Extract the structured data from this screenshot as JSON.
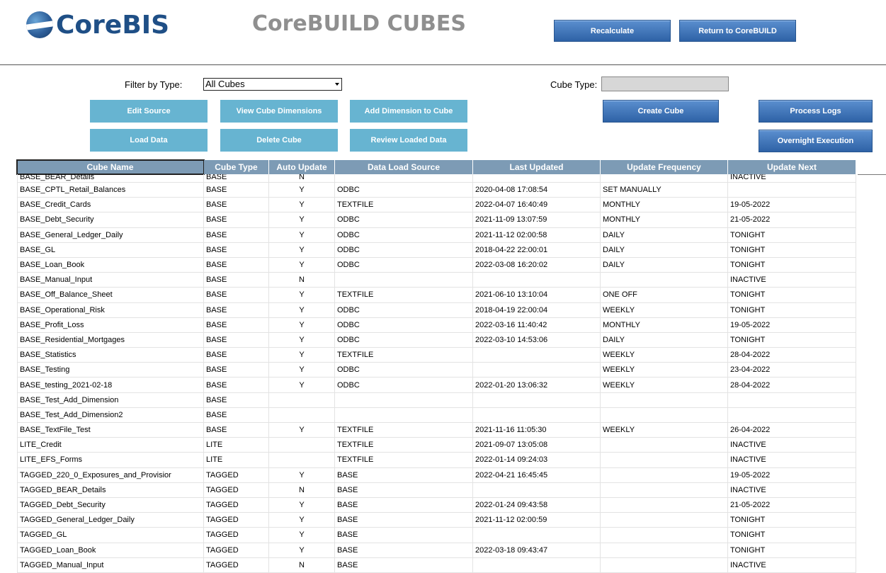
{
  "header": {
    "logo_text": "CoreBIS",
    "app_title": "CoreBUILD CUBES",
    "recalculate_label": "Recalculate",
    "return_label": "Return to CoreBUILD"
  },
  "filters": {
    "filter_by_type_label": "Filter by Type:",
    "filter_by_type_value": "All Cubes",
    "cube_type_label": "Cube Type:",
    "cube_type_value": ""
  },
  "actions": {
    "edit_source": "Edit Source",
    "view_cube_dimensions": "View Cube Dimensions",
    "add_dimension": "Add Dimension to Cube",
    "load_data": "Load Data",
    "delete_cube": "Delete Cube",
    "review_loaded_data": "Review Loaded Data",
    "create_cube": "Create Cube",
    "process_logs": "Process Logs",
    "overnight_execution": "Overnight Execution"
  },
  "table": {
    "columns": [
      "Cube Name",
      "Cube Type",
      "Auto Update",
      "Data Load Source",
      "Last Updated",
      "Update Frequency",
      "Update Next"
    ],
    "rows": [
      [
        "BASE_BEAR_Details",
        "BASE",
        "N",
        "",
        "",
        "",
        "INACTIVE"
      ],
      [
        "BASE_CPTL_Retail_Balances",
        "BASE",
        "Y",
        "ODBC",
        "2020-04-08 17:08:54",
        "SET MANUALLY",
        ""
      ],
      [
        "BASE_Credit_Cards",
        "BASE",
        "Y",
        "TEXTFILE",
        "2022-04-07 16:40:49",
        "MONTHLY",
        "19-05-2022"
      ],
      [
        "BASE_Debt_Security",
        "BASE",
        "Y",
        "ODBC",
        "2021-11-09 13:07:59",
        "MONTHLY",
        "21-05-2022"
      ],
      [
        "BASE_General_Ledger_Daily",
        "BASE",
        "Y",
        "ODBC",
        "2021-11-12 02:00:58",
        "DAILY",
        "TONIGHT"
      ],
      [
        "BASE_GL",
        "BASE",
        "Y",
        "ODBC",
        "2018-04-22 22:00:01",
        "DAILY",
        "TONIGHT"
      ],
      [
        "BASE_Loan_Book",
        "BASE",
        "Y",
        "ODBC",
        "2022-03-08 16:20:02",
        "DAILY",
        "TONIGHT"
      ],
      [
        "BASE_Manual_Input",
        "BASE",
        "N",
        "",
        "",
        "",
        "INACTIVE"
      ],
      [
        "BASE_Off_Balance_Sheet",
        "BASE",
        "Y",
        "TEXTFILE",
        "2021-06-10 13:10:04",
        "ONE OFF",
        "TONIGHT"
      ],
      [
        "BASE_Operational_Risk",
        "BASE",
        "Y",
        "ODBC",
        "2018-04-19 22:00:04",
        "WEEKLY",
        "TONIGHT"
      ],
      [
        "BASE_Profit_Loss",
        "BASE",
        "Y",
        "ODBC",
        "2022-03-16 11:40:42",
        "MONTHLY",
        "19-05-2022"
      ],
      [
        "BASE_Residential_Mortgages",
        "BASE",
        "Y",
        "ODBC",
        "2022-03-10 14:53:06",
        "DAILY",
        "TONIGHT"
      ],
      [
        "BASE_Statistics",
        "BASE",
        "Y",
        "TEXTFILE",
        "",
        "WEEKLY",
        "28-04-2022"
      ],
      [
        "BASE_Testing",
        "BASE",
        "Y",
        "ODBC",
        "",
        "WEEKLY",
        "23-04-2022"
      ],
      [
        "BASE_testing_2021-02-18",
        "BASE",
        "Y",
        "ODBC",
        "2022-01-20 13:06:32",
        "WEEKLY",
        "28-04-2022"
      ],
      [
        "BASE_Test_Add_Dimension",
        "BASE",
        "",
        "",
        "",
        "",
        ""
      ],
      [
        "BASE_Test_Add_Dimension2",
        "BASE",
        "",
        "",
        "",
        "",
        ""
      ],
      [
        "BASE_TextFile_Test",
        "BASE",
        "Y",
        "TEXTFILE",
        "2021-11-16 11:05:30",
        "WEEKLY",
        "26-04-2022"
      ],
      [
        "LITE_Credit",
        "LITE",
        "",
        "TEXTFILE",
        "2021-09-07 13:05:08",
        "",
        "INACTIVE"
      ],
      [
        "LITE_EFS_Forms",
        "LITE",
        "",
        "TEXTFILE",
        "2022-01-14 09:24:03",
        "",
        "INACTIVE"
      ],
      [
        "TAGGED_220_0_Exposures_and_Provisior",
        "TAGGED",
        "Y",
        "BASE",
        "2022-04-21 16:45:45",
        "",
        "19-05-2022"
      ],
      [
        "TAGGED_BEAR_Details",
        "TAGGED",
        "N",
        "BASE",
        "",
        "",
        "INACTIVE"
      ],
      [
        "TAGGED_Debt_Security",
        "TAGGED",
        "Y",
        "BASE",
        "2022-01-24 09:43:58",
        "",
        "21-05-2022"
      ],
      [
        "TAGGED_General_Ledger_Daily",
        "TAGGED",
        "Y",
        "BASE",
        "2021-11-12 02:00:59",
        "",
        "TONIGHT"
      ],
      [
        "TAGGED_GL",
        "TAGGED",
        "Y",
        "BASE",
        "",
        "",
        "TONIGHT"
      ],
      [
        "TAGGED_Loan_Book",
        "TAGGED",
        "Y",
        "BASE",
        "2022-03-18 09:43:47",
        "",
        "TONIGHT"
      ],
      [
        "TAGGED_Manual_Input",
        "TAGGED",
        "N",
        "BASE",
        "",
        "",
        "INACTIVE"
      ]
    ]
  }
}
